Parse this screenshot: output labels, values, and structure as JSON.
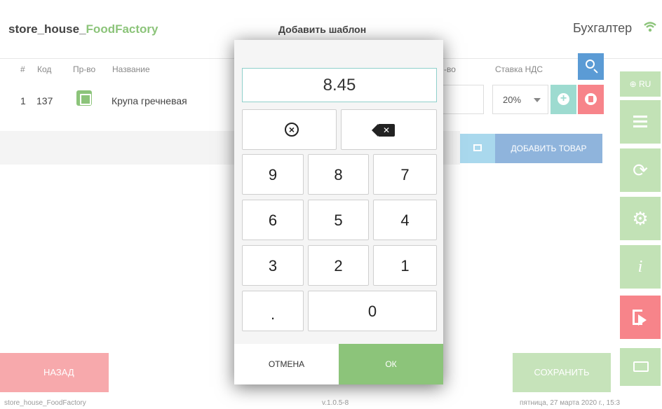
{
  "header": {
    "brand_prefix": "store_house_",
    "brand_accent": "FoodFactory",
    "page_title": "Добавить шаблон",
    "user_role": "Бухгалтер"
  },
  "table": {
    "columns": [
      "#",
      "Код",
      "Пр-во",
      "Название",
      "-во",
      "Ставка НДС"
    ],
    "rows": [
      {
        "num": "1",
        "code": "137",
        "name": "Крупа гречневая",
        "vat": "20%"
      }
    ]
  },
  "actions": {
    "add_product": "ДОБАВИТЬ ТОВАР",
    "back": "НАЗАД",
    "save": "СОХРАНИТЬ"
  },
  "sidebar": {
    "lang": "⊕ RU"
  },
  "footer": {
    "app": "store_house_FoodFactory",
    "version": "v.1.0.5-8",
    "date": "пятница, 27 марта 2020 г., 15:3"
  },
  "numpad": {
    "value": "8.45",
    "keys_row1": [
      "9",
      "8",
      "7"
    ],
    "keys_row2": [
      "6",
      "5",
      "4"
    ],
    "keys_row3": [
      "3",
      "2",
      "1"
    ],
    "dot": ".",
    "zero": "0",
    "cancel": "ОТМЕНА",
    "ok": "ОК"
  },
  "colors": {
    "accent_green": "#8cc47a",
    "accent_red": "#f7848a",
    "accent_blue": "#5b9bd5",
    "teal": "#9ddbd0"
  },
  "icons": [
    "wifi-icon",
    "search-icon",
    "plus-icon",
    "trash-icon",
    "barcode-icon",
    "globe-icon",
    "menu-icon",
    "sync-icon",
    "gear-icon",
    "info-icon",
    "logout-icon",
    "keyboard-icon",
    "clear-icon",
    "backspace-icon",
    "product-icon"
  ]
}
